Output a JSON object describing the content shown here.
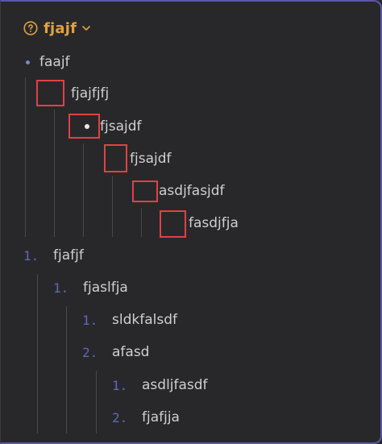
{
  "header": {
    "title": "fjajf",
    "help_icon": "help-circle-icon",
    "chevron_icon": "chevron-down-icon",
    "accent_color": "#e0a23d"
  },
  "bullet_list": {
    "items": [
      {
        "label": "faajf"
      },
      {
        "label": "fjajfjfj"
      },
      {
        "label": "fjsajdf"
      },
      {
        "label": "fjsajdf"
      },
      {
        "label": "asdjfasjdf"
      },
      {
        "label": "fasdjfja"
      }
    ],
    "highlight_color": "#e04242"
  },
  "numbered_list": {
    "items": [
      {
        "number": "1.",
        "label": "fjafjf"
      },
      {
        "number": "1.",
        "label": "fjaslfja"
      },
      {
        "number": "1.",
        "label": "sldkfalsdf"
      },
      {
        "number": "2.",
        "label": "afasd"
      },
      {
        "number": "1.",
        "label": "asdljfasdf"
      },
      {
        "number": "2.",
        "label": "fjafjja"
      }
    ],
    "number_color": "#5e68b8"
  }
}
